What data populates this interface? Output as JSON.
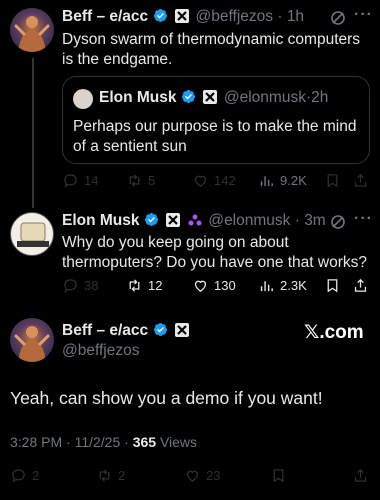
{
  "tweet1": {
    "name": "Beff – e/acc",
    "handle": "@beffjezos",
    "time": "1h",
    "text": "Dyson swarm of thermodynamic computers is the endgame.",
    "quote": {
      "name": "Elon Musk",
      "handle": "@elonmusk",
      "time": "2h",
      "text": "Perhaps our purpose is to make the mind of a sentient sun"
    },
    "actions": {
      "replies": "14",
      "reposts": "5",
      "likes": "142",
      "views": "9.2K"
    }
  },
  "tweet2": {
    "name": "Elon Musk",
    "handle": "@elonmusk",
    "time": "3m",
    "text": "Why do you keep going on about thermoputers? Do you have one that works?",
    "actions": {
      "replies": "38",
      "reposts": "12",
      "likes": "130",
      "views": "2.3K"
    }
  },
  "tweet3": {
    "name": "Beff – e/acc",
    "handle": "@beffjezos",
    "text": "Yeah, can show you a demo if you want!",
    "timestamp": "3:28 PM · 11/2/25 · ",
    "views_count": "365",
    "views_label": " Views",
    "actions": {
      "replies": "2",
      "reposts": "2",
      "likes": "23"
    }
  },
  "watermark": {
    "x": "𝕏",
    "dotcom": ".com"
  },
  "colors": {
    "background": "#000000",
    "text": "#e7e9ea",
    "muted": "#71767b",
    "verified": "#1d9bf0",
    "divider": "#2f3336"
  }
}
